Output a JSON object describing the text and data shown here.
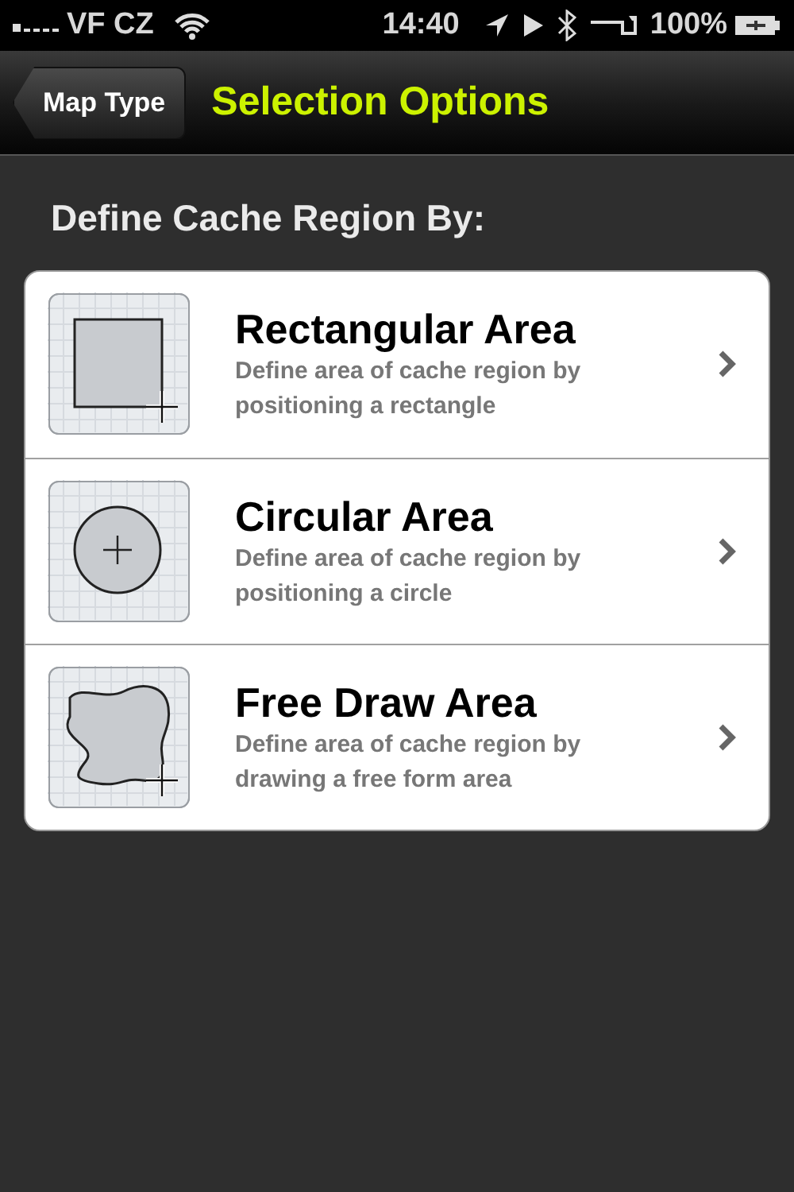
{
  "status_bar": {
    "carrier": "VF CZ",
    "time": "14:40",
    "battery": "100%"
  },
  "nav_bar": {
    "back_button": "Map Type",
    "title": "Selection Options"
  },
  "section_header": "Define Cache Region By:",
  "options": [
    {
      "kind": "rectangle",
      "title": "Rectangular Area",
      "description": "Define area of cache region by positioning a rectangle"
    },
    {
      "kind": "circle",
      "title": "Circular Area",
      "description": "Define area of cache region by positioning a circle"
    },
    {
      "kind": "freeform",
      "title": "Free Draw Area",
      "description": "Define area of cache region by drawing a free form area"
    }
  ]
}
